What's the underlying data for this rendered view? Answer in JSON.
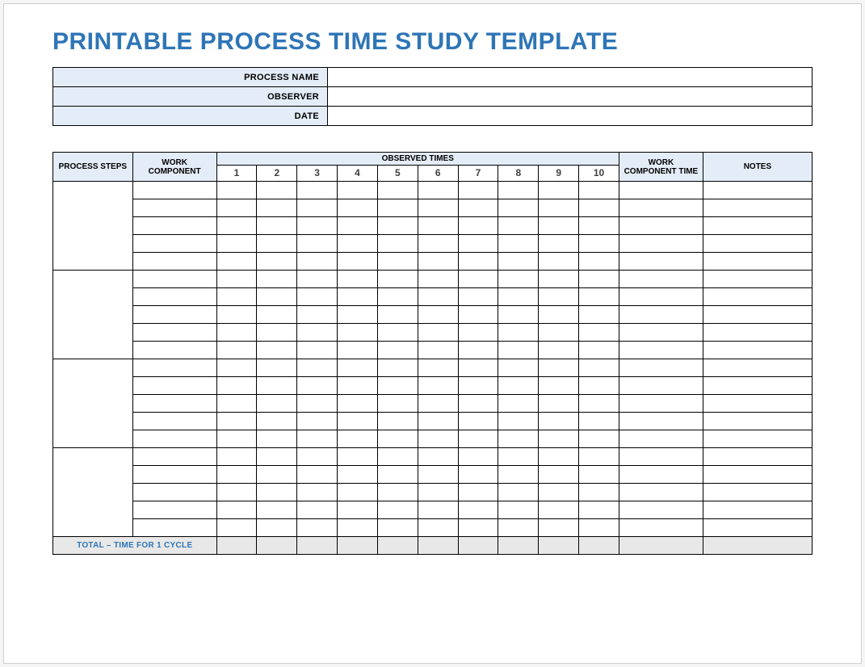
{
  "title": "PRINTABLE PROCESS TIME STUDY TEMPLATE",
  "info": {
    "process_name_label": "PROCESS NAME",
    "process_name_value": "",
    "observer_label": "OBSERVER",
    "observer_value": "",
    "date_label": "DATE",
    "date_value": ""
  },
  "headers": {
    "process_steps": "PROCESS STEPS",
    "work_component": "WORK COMPONENT",
    "observed_times": "OBSERVED TIMES",
    "wct": "WORK COMPONENT TIME",
    "notes": "NOTES",
    "nums": [
      "1",
      "2",
      "3",
      "4",
      "5",
      "6",
      "7",
      "8",
      "9",
      "10"
    ]
  },
  "groups": [
    {
      "rows": 5
    },
    {
      "rows": 5
    },
    {
      "rows": 5
    },
    {
      "rows": 5
    }
  ],
  "total_label": "TOTAL – TIME FOR 1 CYCLE"
}
